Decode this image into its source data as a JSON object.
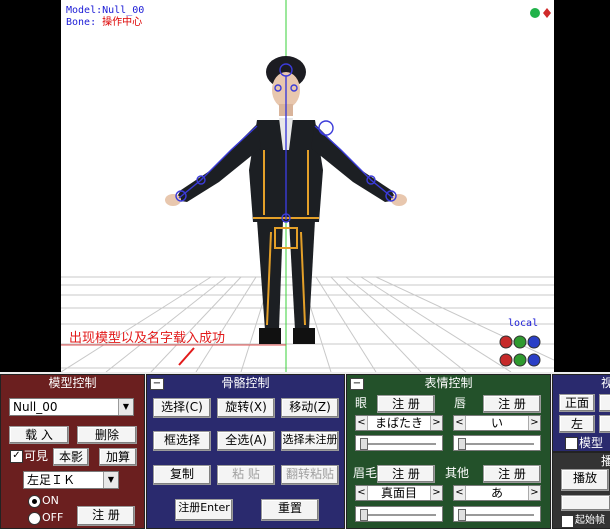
{
  "viewport": {
    "model_line": "Model:Null_00",
    "bone_prefix": "Bone: ",
    "bone_value": "操作中心",
    "local_label": "local"
  },
  "annotation": "出现模型以及名字载入成功",
  "model_panel": {
    "title": "模型控制",
    "model_select": "Null_00",
    "load_label": "载 入",
    "delete_label": "删除",
    "visible_label": "可見",
    "visible_checked": true,
    "shadow_label": "本影",
    "add_label": "加算",
    "ik_select": "左足ＩＫ",
    "on_label": "ON",
    "off_label": "OFF",
    "register_label": "注 册"
  },
  "bone_panel": {
    "title": "骨骼控制",
    "select_label": "选择(C)",
    "rotate_label": "旋转(X)",
    "move_label": "移动(Z)",
    "box_select_label": "框选择",
    "select_all_label": "全选(A)",
    "select_unreg_label": "选择未注册",
    "copy_label": "复制",
    "paste_label": "粘 贴",
    "flip_paste_label": "翻转粘贴",
    "register_enter_label": "注册Enter",
    "reset_label": "重置"
  },
  "face_panel": {
    "title": "表情控制",
    "eye_label": "眼",
    "eye_register": "注 册",
    "eye_value": "まばたき",
    "lip_label": "唇",
    "lip_register": "注 册",
    "lip_value": "い",
    "brow_label": "眉毛",
    "brow_register": "注 册",
    "brow_value": "真面目",
    "other_label": "其他",
    "other_register": "注 册",
    "other_value": "あ"
  },
  "view_panel": {
    "title_fragment": "视",
    "front_label": "正面",
    "left_label": "左",
    "model_check_label": "模型"
  },
  "play_panel": {
    "title_fragment": "播",
    "play_label": "播放",
    "start_frame_label": "起始帧"
  },
  "colors": {
    "model_panel": "#6b1f1f",
    "bone_panel": "#2a2a6e",
    "face_panel": "#23512a",
    "view_panel": "#2a2a6e",
    "play_panel": "#333333"
  }
}
